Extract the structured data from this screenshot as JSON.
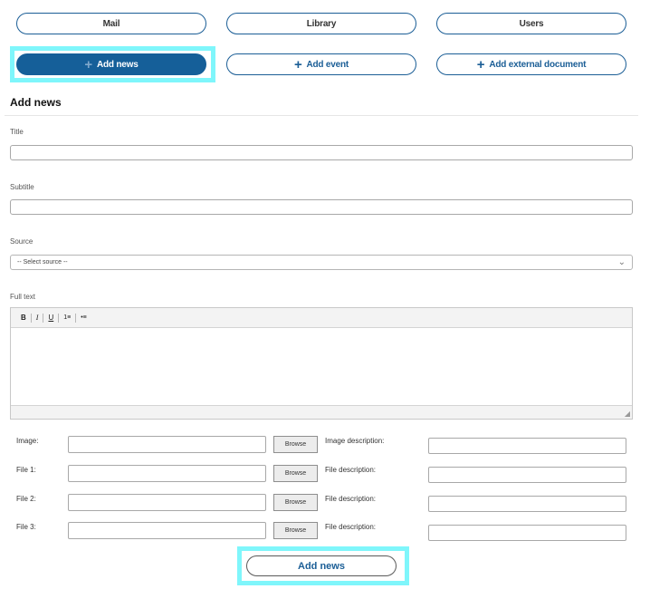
{
  "nav": {
    "mail": "Mail",
    "library": "Library",
    "users": "Users",
    "add_news": "Add news",
    "add_event": "Add event",
    "add_external_document": "Add external document",
    "plus_icon": "plus-icon"
  },
  "form": {
    "title": "Add news",
    "title_label": "Title",
    "title_value": "",
    "subtitle_label": "Subtitle",
    "subtitle_value": "",
    "source_label": "Source",
    "source_selected": "-- Select source --",
    "fulltext_label": "Full text",
    "editor_toolbar": {
      "bold": "B",
      "italic": "I",
      "underline": "U",
      "ordered_list": "1≡",
      "bullet_list": "•≡"
    },
    "attachments": [
      {
        "label": "Image:",
        "browse": "Browse",
        "desc_label": "Image description:"
      },
      {
        "label": "File 1:",
        "browse": "Browse",
        "desc_label": "File description:"
      },
      {
        "label": "File 2:",
        "browse": "Browse",
        "desc_label": "File description:"
      },
      {
        "label": "File 3:",
        "browse": "Browse",
        "desc_label": "File description:"
      }
    ],
    "submit_label": "Add news"
  },
  "colors": {
    "primary": "#155f99",
    "highlight": "#7ff6fb"
  }
}
